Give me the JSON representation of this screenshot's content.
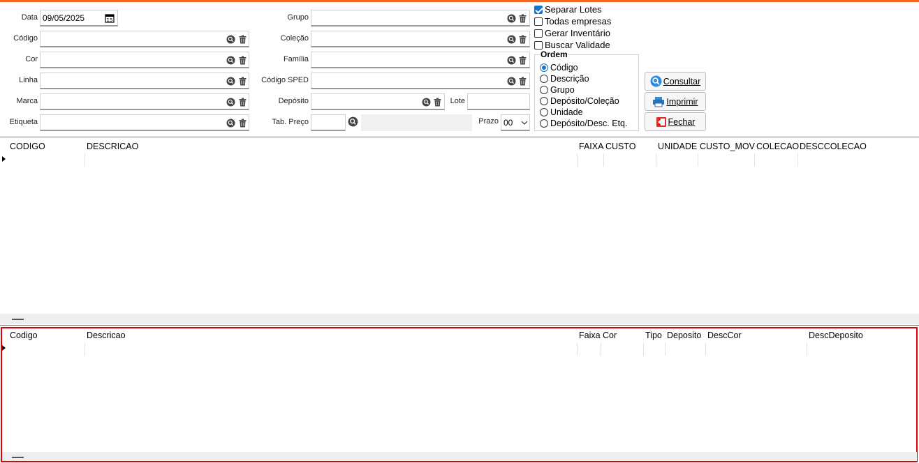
{
  "filters_left": {
    "date_label": "Data",
    "date_value": "09/05/2025",
    "codigo_label": "Código",
    "cor_label": "Cor",
    "linha_label": "Linha",
    "marca_label": "Marca",
    "etiqueta_label": "Etiqueta"
  },
  "filters_mid": {
    "grupo_label": "Grupo",
    "colecao_label": "Coleção",
    "familia_label": "Família",
    "codigo_sped_label": "Código SPED",
    "deposito_label": "Depósito",
    "lote_label": "Lote",
    "tab_preco_label": "Tab. Preço",
    "prazo_label": "Prazo",
    "prazo_value": "00"
  },
  "options": {
    "separar_lotes": "Separar Lotes",
    "todas_empresas": "Todas empresas",
    "gerar_inventario": "Gerar Inventário",
    "buscar_validade": "Buscar Validade"
  },
  "ordem": {
    "title": "Ordem",
    "items": [
      "Código",
      "Descrição",
      "Grupo",
      "Depósito/Coleção",
      "Unidade",
      "Depósito/Desc. Etq."
    ]
  },
  "buttons": {
    "consultar": "Consultar",
    "imprimir": "Imprimir",
    "fechar": "Fechar"
  },
  "grid_top": {
    "columns": [
      "CODIGO",
      "DESCRICAO",
      "FAIXA",
      "CUSTO",
      "UNIDADE",
      "CUSTO_MOV",
      "COLECAO",
      "DESCCOLECAO"
    ]
  },
  "grid_bottom": {
    "columns": [
      "Codigo",
      "Descricao",
      "Faixa",
      "Cor",
      "Tipo",
      "Deposito",
      "DescCor",
      "DescDeposito"
    ]
  },
  "colors": {
    "accent": "#f26522",
    "highlight_border": "#e00000",
    "check_blue": "#1a73c9"
  }
}
